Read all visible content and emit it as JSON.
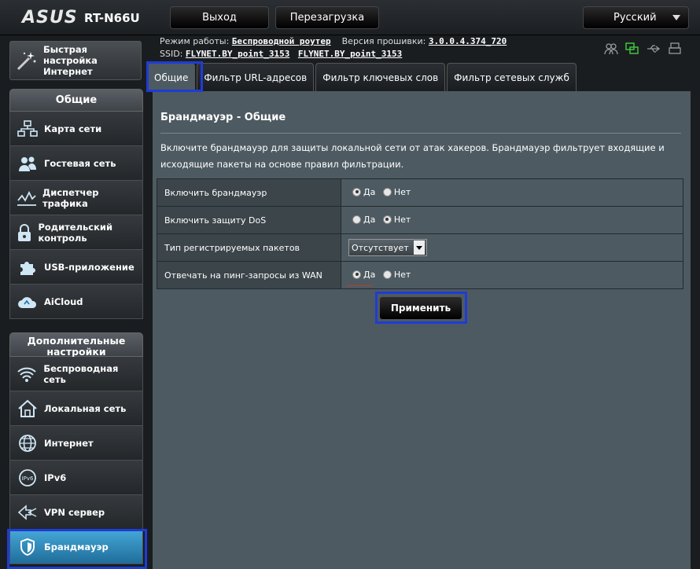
{
  "header": {
    "logo": "ASUS",
    "model": "RT-N66U",
    "logout_label": "Выход",
    "reboot_label": "Перезагрузка",
    "language": "Русский"
  },
  "info": {
    "mode_label": "Режим работы:",
    "mode_value": "Беспроводной роутер",
    "firmware_label": "Версия прошивки:",
    "firmware_value": "3.0.0.4.374_720",
    "ssid_label": "SSID:",
    "ssid_1": "FLYNET.BY_point_3153",
    "ssid_2": "FLYNET.BY_point_3153"
  },
  "sidebar": {
    "qis_label": "Быстрая настройка Интернет",
    "general_header": "Общие",
    "general_items": [
      {
        "label": "Карта сети",
        "icon": "network-map-icon"
      },
      {
        "label": "Гостевая сеть",
        "icon": "guest-network-icon"
      },
      {
        "label": "Диспетчер трафика",
        "icon": "traffic-manager-icon"
      },
      {
        "label": "Родительский контроль",
        "icon": "parental-control-icon"
      },
      {
        "label": "USB-приложение",
        "icon": "usb-app-icon"
      },
      {
        "label": "AiCloud",
        "icon": "aicloud-icon"
      }
    ],
    "advanced_header": "Дополнительные настройки",
    "advanced_items": [
      {
        "label": "Беспроводная сеть",
        "icon": "wireless-icon"
      },
      {
        "label": "Локальная сеть",
        "icon": "lan-icon"
      },
      {
        "label": "Интернет",
        "icon": "wan-globe-icon"
      },
      {
        "label": "IPv6",
        "icon": "ipv6-icon"
      },
      {
        "label": "VPN сервер",
        "icon": "vpn-icon"
      },
      {
        "label": "Брандмауэр",
        "icon": "firewall-icon"
      }
    ]
  },
  "tabs": [
    "Общие",
    "Фильтр URL-адресов",
    "Фильтр ключевых слов",
    "Фильтр сетевых служб"
  ],
  "panel": {
    "title": "Брандмауэр - Общие",
    "description": "Включите брандмауэр для защиты локальной сети от атак хакеров. Брандмауэр фильтрует входящие и исходящие пакеты на основе правил фильтрации.",
    "rows": [
      {
        "label": "Включить брандмауэр",
        "yes": "Да",
        "no": "Нет",
        "selected": "yes"
      },
      {
        "label": "Включить защиту DoS",
        "yes": "Да",
        "no": "Нет",
        "selected": "no"
      },
      {
        "label": "Тип регистрируемых пакетов",
        "select_value": "Отсутствует"
      },
      {
        "label": "Отвечать на пинг-запросы из WAN",
        "yes": "Да",
        "no": "Нет",
        "selected": "yes"
      }
    ],
    "apply_label": "Применить"
  },
  "colors": {
    "panel_bg": "#4d5a61",
    "highlight_box": "#1e3cd6",
    "active_nav": "#2f8cc0"
  }
}
